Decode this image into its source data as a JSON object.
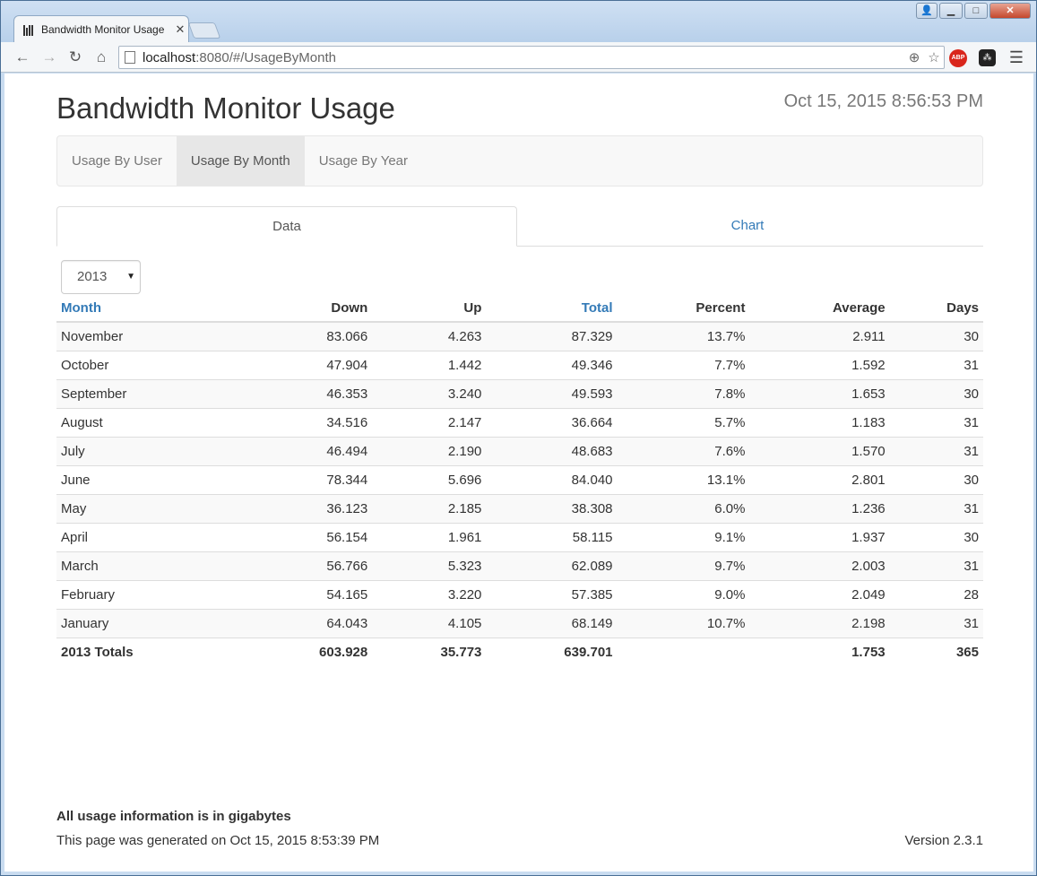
{
  "browser": {
    "tab_title": "Bandwidth Monitor Usage",
    "tab_close": "✕",
    "url_host": "localhost",
    "url_rest": ":8080/#/UsageByMonth",
    "abp_label": "ABP"
  },
  "page": {
    "title": "Bandwidth Monitor Usage",
    "clock": "Oct 15, 2015 8:56:53 PM"
  },
  "nav": {
    "items": [
      {
        "label": "Usage By User"
      },
      {
        "label": "Usage By Month"
      },
      {
        "label": "Usage By Year"
      }
    ],
    "active_index": 1
  },
  "tabs": {
    "data": "Data",
    "chart": "Chart"
  },
  "year_select": {
    "value": "2013"
  },
  "table": {
    "headers": {
      "month": "Month",
      "down": "Down",
      "up": "Up",
      "total": "Total",
      "percent": "Percent",
      "average": "Average",
      "days": "Days"
    },
    "rows": [
      {
        "month": "November",
        "down": "83.066",
        "up": "4.263",
        "total": "87.329",
        "percent": "13.7%",
        "average": "2.911",
        "days": "30"
      },
      {
        "month": "October",
        "down": "47.904",
        "up": "1.442",
        "total": "49.346",
        "percent": "7.7%",
        "average": "1.592",
        "days": "31"
      },
      {
        "month": "September",
        "down": "46.353",
        "up": "3.240",
        "total": "49.593",
        "percent": "7.8%",
        "average": "1.653",
        "days": "30"
      },
      {
        "month": "August",
        "down": "34.516",
        "up": "2.147",
        "total": "36.664",
        "percent": "5.7%",
        "average": "1.183",
        "days": "31"
      },
      {
        "month": "July",
        "down": "46.494",
        "up": "2.190",
        "total": "48.683",
        "percent": "7.6%",
        "average": "1.570",
        "days": "31"
      },
      {
        "month": "June",
        "down": "78.344",
        "up": "5.696",
        "total": "84.040",
        "percent": "13.1%",
        "average": "2.801",
        "days": "30"
      },
      {
        "month": "May",
        "down": "36.123",
        "up": "2.185",
        "total": "38.308",
        "percent": "6.0%",
        "average": "1.236",
        "days": "31"
      },
      {
        "month": "April",
        "down": "56.154",
        "up": "1.961",
        "total": "58.115",
        "percent": "9.1%",
        "average": "1.937",
        "days": "30"
      },
      {
        "month": "March",
        "down": "56.766",
        "up": "5.323",
        "total": "62.089",
        "percent": "9.7%",
        "average": "2.003",
        "days": "31"
      },
      {
        "month": "February",
        "down": "54.165",
        "up": "3.220",
        "total": "57.385",
        "percent": "9.0%",
        "average": "2.049",
        "days": "28"
      },
      {
        "month": "January",
        "down": "64.043",
        "up": "4.105",
        "total": "68.149",
        "percent": "10.7%",
        "average": "2.198",
        "days": "31"
      }
    ],
    "totals": {
      "month": "2013 Totals",
      "down": "603.928",
      "up": "35.773",
      "total": "639.701",
      "percent": "",
      "average": "1.753",
      "days": "365"
    }
  },
  "footer": {
    "note": "All usage information is in gigabytes",
    "generated": "This page was generated on Oct 15, 2015 8:53:39 PM",
    "version": "Version 2.3.1"
  },
  "colors": {
    "link": "#337ab7",
    "text": "#333333",
    "muted": "#777777"
  }
}
